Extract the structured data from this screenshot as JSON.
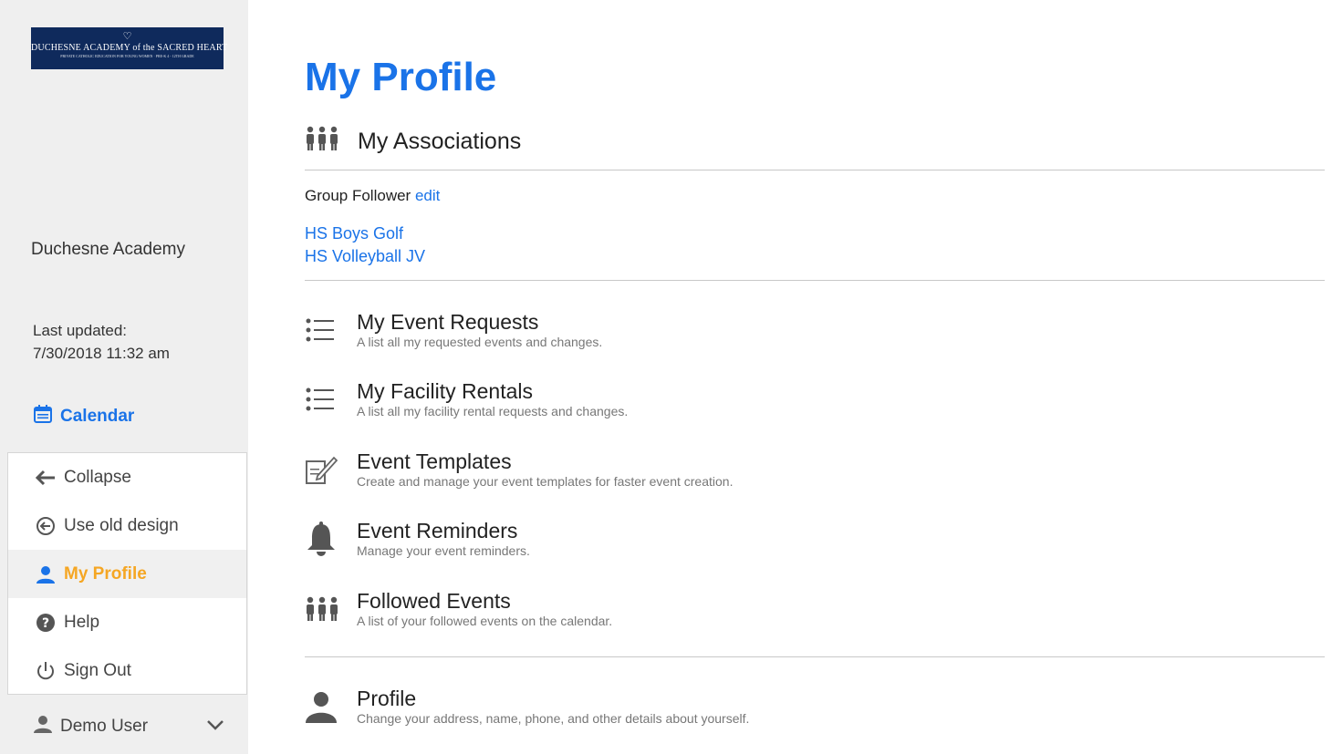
{
  "sidebar": {
    "logo": {
      "line1": "DUCHESNE ACADEMY of the SACRED HEART",
      "line2": "PRIVATE CATHOLIC EDUCATION FOR YOUNG WOMEN · PRE-K 4 - 12TH GRADE"
    },
    "org_name": "Duchesne Academy",
    "last_updated_label": "Last updated:",
    "last_updated_value": "7/30/2018 11:32 am",
    "calendar_label": "Calendar",
    "menu": [
      {
        "label": "Collapse",
        "icon": "arrow-left-icon"
      },
      {
        "label": "Use old design",
        "icon": "circle-arrow-left-icon"
      },
      {
        "label": "My Profile",
        "icon": "person-icon",
        "active": true
      },
      {
        "label": "Help",
        "icon": "question-circle-icon"
      },
      {
        "label": "Sign Out",
        "icon": "power-icon"
      }
    ],
    "user_name": "Demo User"
  },
  "main": {
    "title": "My Profile",
    "associations": {
      "heading": "My Associations",
      "group_follower_label": "Group Follower",
      "edit_label": "edit",
      "groups": [
        "HS Boys Golf",
        "HS Volleyball JV"
      ]
    },
    "features": [
      {
        "title": "My Event Requests",
        "desc": "A list all my requested events and changes.",
        "icon": "list-icon"
      },
      {
        "title": "My Facility Rentals",
        "desc": "A list all my facility rental requests and changes.",
        "icon": "list-icon"
      },
      {
        "title": "Event Templates",
        "desc": "Create and manage your event templates for faster event creation.",
        "icon": "edit-document-icon"
      },
      {
        "title": "Event Reminders",
        "desc": "Manage your event reminders.",
        "icon": "bell-icon"
      },
      {
        "title": "Followed Events",
        "desc": "A list of your followed events on the calendar.",
        "icon": "group-icon"
      },
      {
        "title": "Profile",
        "desc": "Change your address, name, phone, and other details about yourself.",
        "icon": "person-icon"
      }
    ]
  },
  "colors": {
    "accent_blue": "#1a73e8",
    "active_orange": "#f5a623",
    "sidebar_bg": "#efefef",
    "logo_bg": "#0f2a5c"
  }
}
